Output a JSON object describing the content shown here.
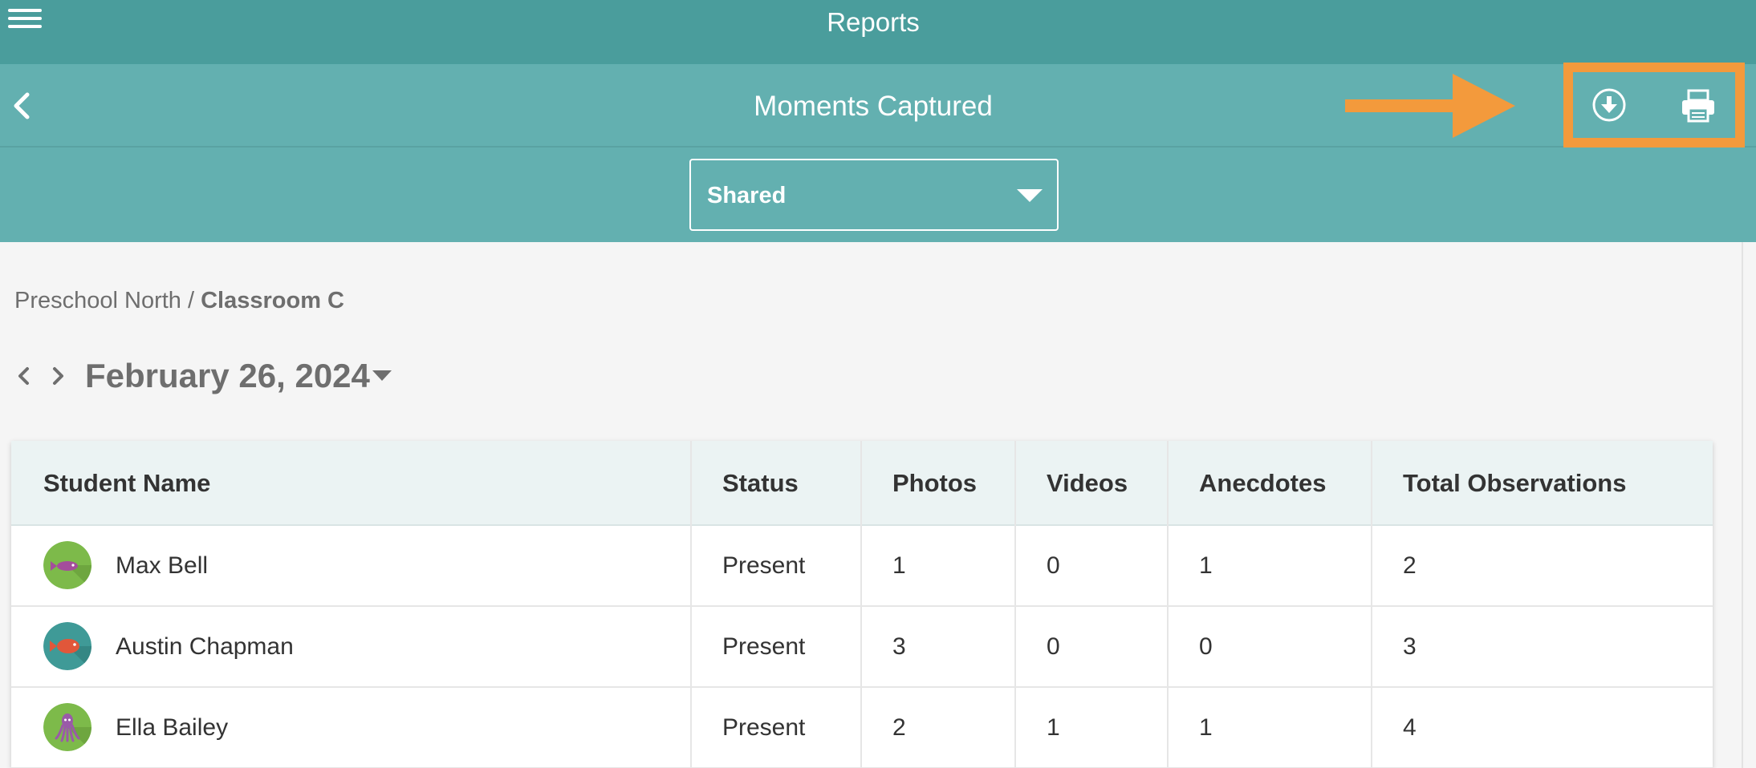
{
  "app": {
    "title": "Reports"
  },
  "header": {
    "title": "Moments Captured"
  },
  "filter": {
    "selected": "Shared"
  },
  "breadcrumb": {
    "school": "Preschool North",
    "separator": " / ",
    "classroom": "Classroom C"
  },
  "date": {
    "label": "February 26, 2024"
  },
  "icons": {
    "menu": "menu-icon",
    "back": "chevron-left-icon",
    "download": "download-icon",
    "print": "print-icon",
    "annotation_arrow": "arrow-right-icon"
  },
  "colors": {
    "topbar": "#4a9d9c",
    "subbar": "#63b0b0",
    "highlight": "#f39a3c",
    "table_header": "#ebf3f3"
  },
  "table": {
    "columns": [
      "Student Name",
      "Status",
      "Photos",
      "Videos",
      "Anecdotes",
      "Total Observations"
    ],
    "rows": [
      {
        "name": "Max Bell",
        "avatar": "purple-fish",
        "status": "Present",
        "photos": "1",
        "videos": "0",
        "anecdotes": "1",
        "total": "2"
      },
      {
        "name": "Austin Chapman",
        "avatar": "red-fish",
        "status": "Present",
        "photos": "3",
        "videos": "0",
        "anecdotes": "0",
        "total": "3"
      },
      {
        "name": "Ella Bailey",
        "avatar": "purple-octopus",
        "status": "Present",
        "photos": "2",
        "videos": "1",
        "anecdotes": "1",
        "total": "4"
      }
    ]
  }
}
